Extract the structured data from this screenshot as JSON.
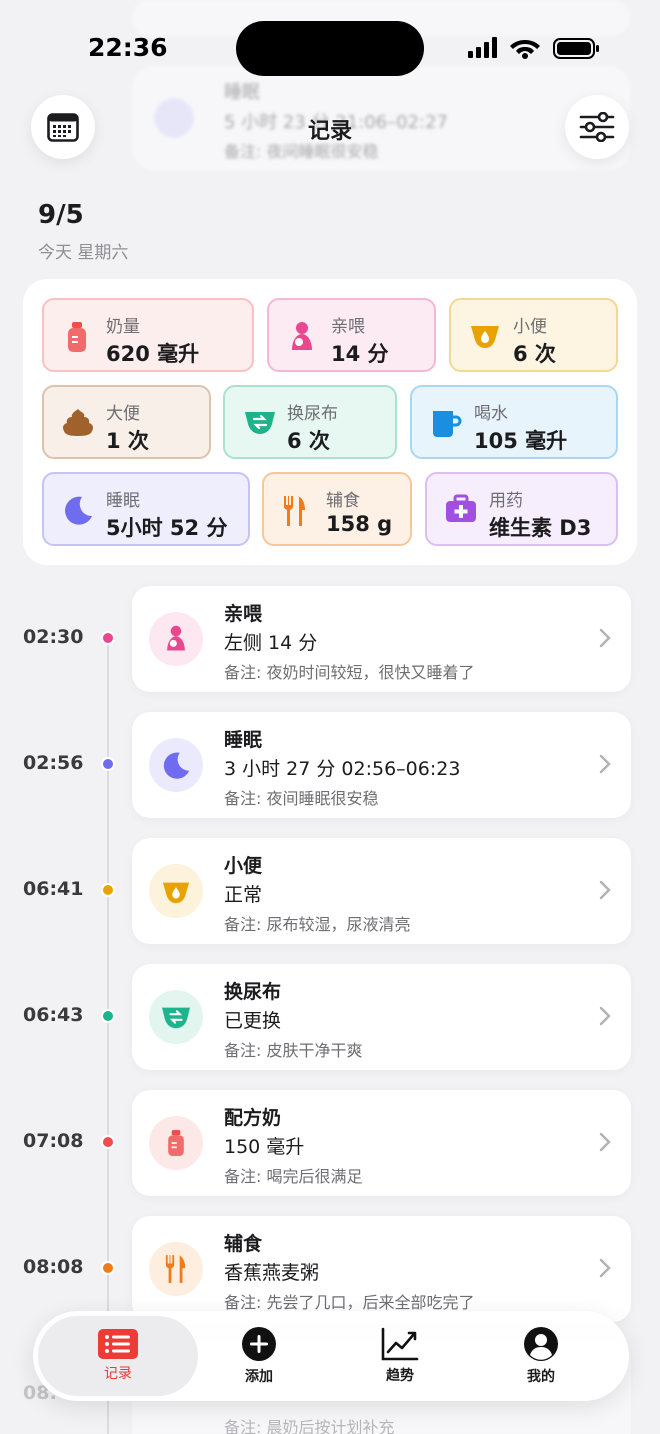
{
  "status": {
    "time": "22:36"
  },
  "header": {
    "title": "记录",
    "date": "9/5",
    "date_sub": "今天 星期六"
  },
  "summary": [
    {
      "label": "奶量",
      "value": "620 毫升",
      "icon": "bottle-icon"
    },
    {
      "label": "亲喂",
      "value": "14 分",
      "icon": "breastfeed-icon"
    },
    {
      "label": "小便",
      "value": "6 次",
      "icon": "pee-icon"
    },
    {
      "label": "大便",
      "value": "1 次",
      "icon": "poop-icon"
    },
    {
      "label": "换尿布",
      "value": "6 次",
      "icon": "diaper-icon"
    },
    {
      "label": "喝水",
      "value": "105 毫升",
      "icon": "cup-icon"
    },
    {
      "label": "睡眠",
      "value": "5小时 52 分",
      "icon": "moon-icon"
    },
    {
      "label": "辅食",
      "value": "158 g",
      "icon": "fork-knife-icon"
    },
    {
      "label": "用药",
      "value": "维生素 D3",
      "icon": "medicine-kit-icon"
    }
  ],
  "timeline": [
    {
      "time": "02:30",
      "title": "亲喂",
      "detail": "左侧 14 分",
      "note": "备注: 夜奶时间较短，很快又睡着了"
    },
    {
      "time": "02:56",
      "title": "睡眠",
      "detail": "3 小时 27 分 02:56–06:23",
      "note": "备注: 夜间睡眠很安稳"
    },
    {
      "time": "06:41",
      "title": "小便",
      "detail": "正常",
      "note": "备注: 尿布较湿，尿液清亮"
    },
    {
      "time": "06:43",
      "title": "换尿布",
      "detail": "已更换",
      "note": "备注: 皮肤干净干爽"
    },
    {
      "time": "07:08",
      "title": "配方奶",
      "detail": "150 毫升",
      "note": "备注: 喝完后很满足"
    },
    {
      "time": "08:08",
      "title": "辅食",
      "detail": "香蕉燕麦粥",
      "note": "备注: 先尝了几口，后来全部吃完了"
    }
  ],
  "ghost": {
    "top_title": "睡眠",
    "top_detail": "5 小时 23 分 21:06–02:27",
    "top_note": "备注: 夜间睡眠很安稳",
    "bottom_time": "08:",
    "bottom_note": "备注: 晨奶后按计划补充"
  },
  "tabs": [
    {
      "label": "记录",
      "icon": "list-icon"
    },
    {
      "label": "添加",
      "icon": "plus-circle-icon"
    },
    {
      "label": "趋势",
      "icon": "trend-chart-icon"
    },
    {
      "label": "我的",
      "icon": "profile-icon"
    }
  ],
  "colors": {
    "accent": "#e53935",
    "feed": "#e9488f",
    "sleep": "#6f6cf0",
    "pee": "#e8a300",
    "diaper": "#1db38b",
    "formula": "#ef4c4c",
    "solid": "#f07b1a"
  }
}
